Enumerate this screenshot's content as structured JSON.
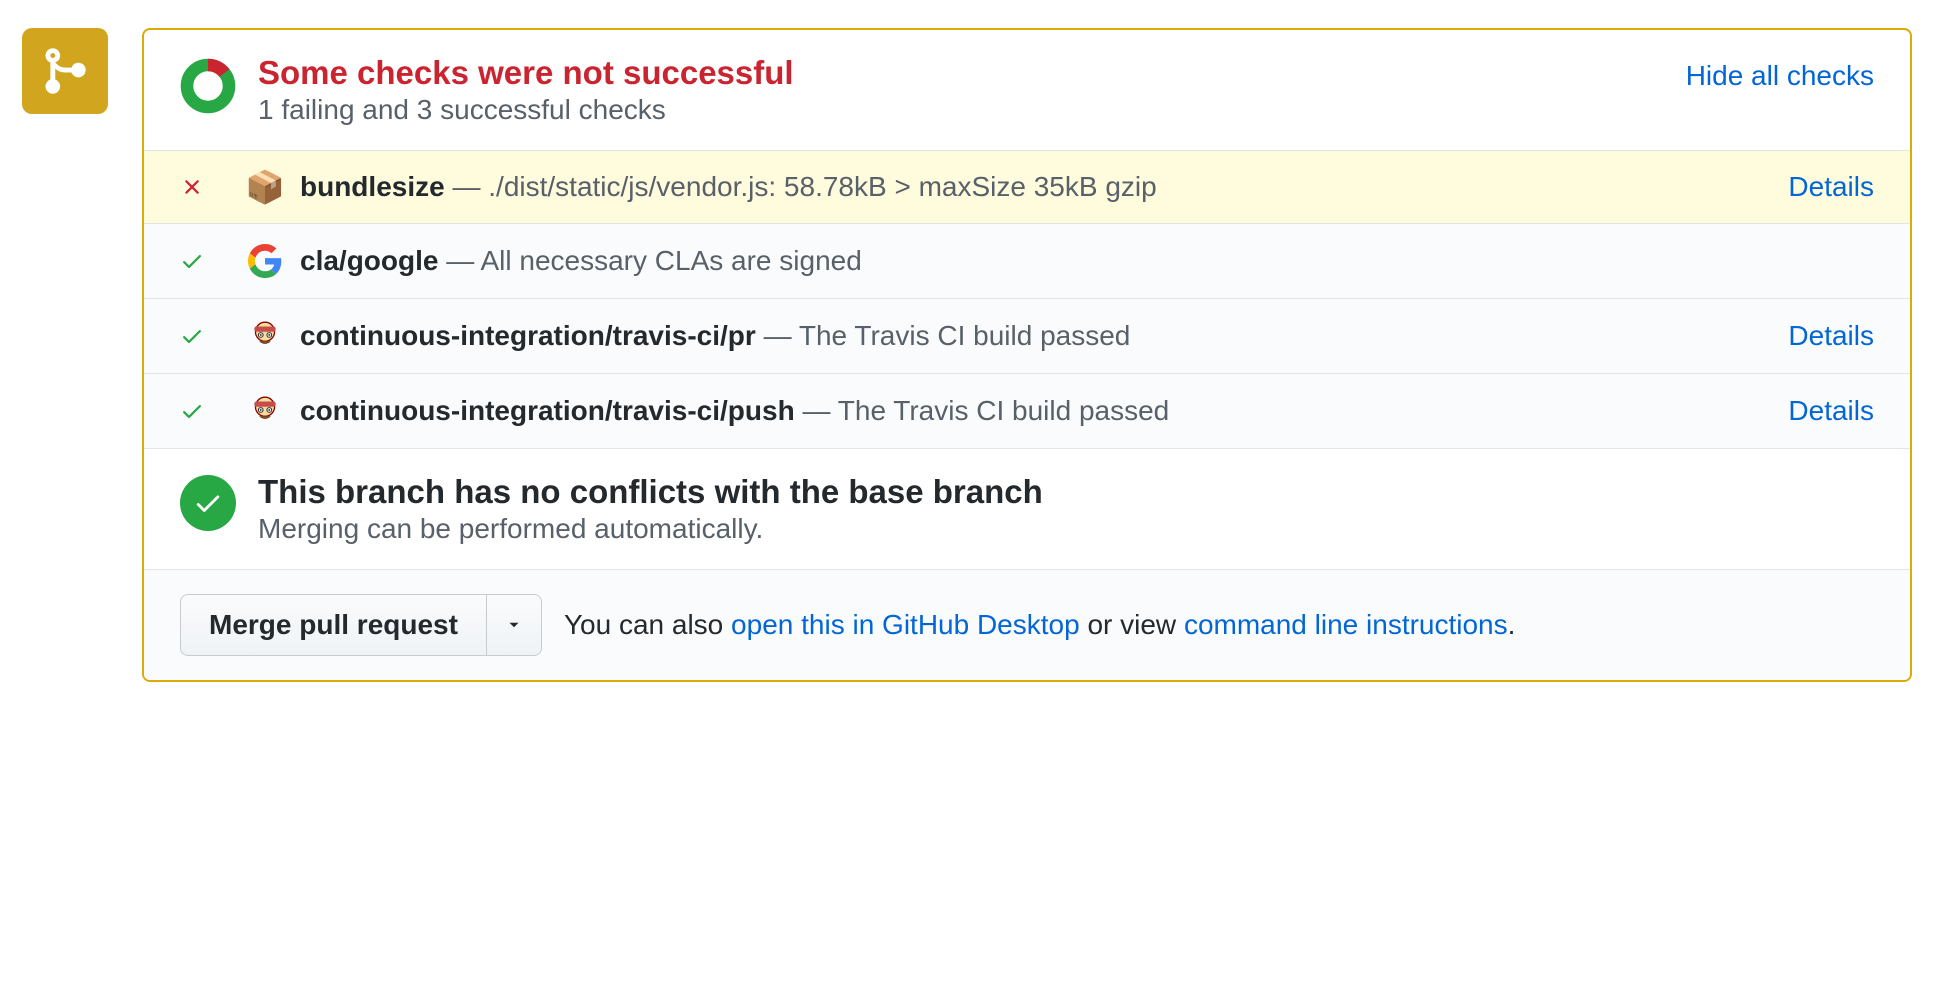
{
  "header": {
    "title": "Some checks were not successful",
    "subtitle": "1 failing and 3 successful checks",
    "hide_link": "Hide all checks"
  },
  "checks": [
    {
      "status": "fail",
      "icon": "package",
      "name": "bundlesize",
      "desc": "./dist/static/js/vendor.js: 58.78kB > maxSize 35kB gzip",
      "details": "Details"
    },
    {
      "status": "pass",
      "icon": "google",
      "name": "cla/google",
      "desc": "All necessary CLAs are signed",
      "details": ""
    },
    {
      "status": "pass",
      "icon": "travis",
      "name": "continuous-integration/travis-ci/pr",
      "desc": "The Travis CI build passed",
      "details": "Details"
    },
    {
      "status": "pass",
      "icon": "travis",
      "name": "continuous-integration/travis-ci/push",
      "desc": "The Travis CI build passed",
      "details": "Details"
    }
  ],
  "merge": {
    "title": "This branch has no conflicts with the base branch",
    "subtitle": "Merging can be performed automatically."
  },
  "footer": {
    "merge_button": "Merge pull request",
    "text_prefix": "You can also ",
    "desktop_link": "open this in GitHub Desktop",
    "text_middle": " or view ",
    "cli_link": "command line instructions",
    "text_suffix": "."
  }
}
